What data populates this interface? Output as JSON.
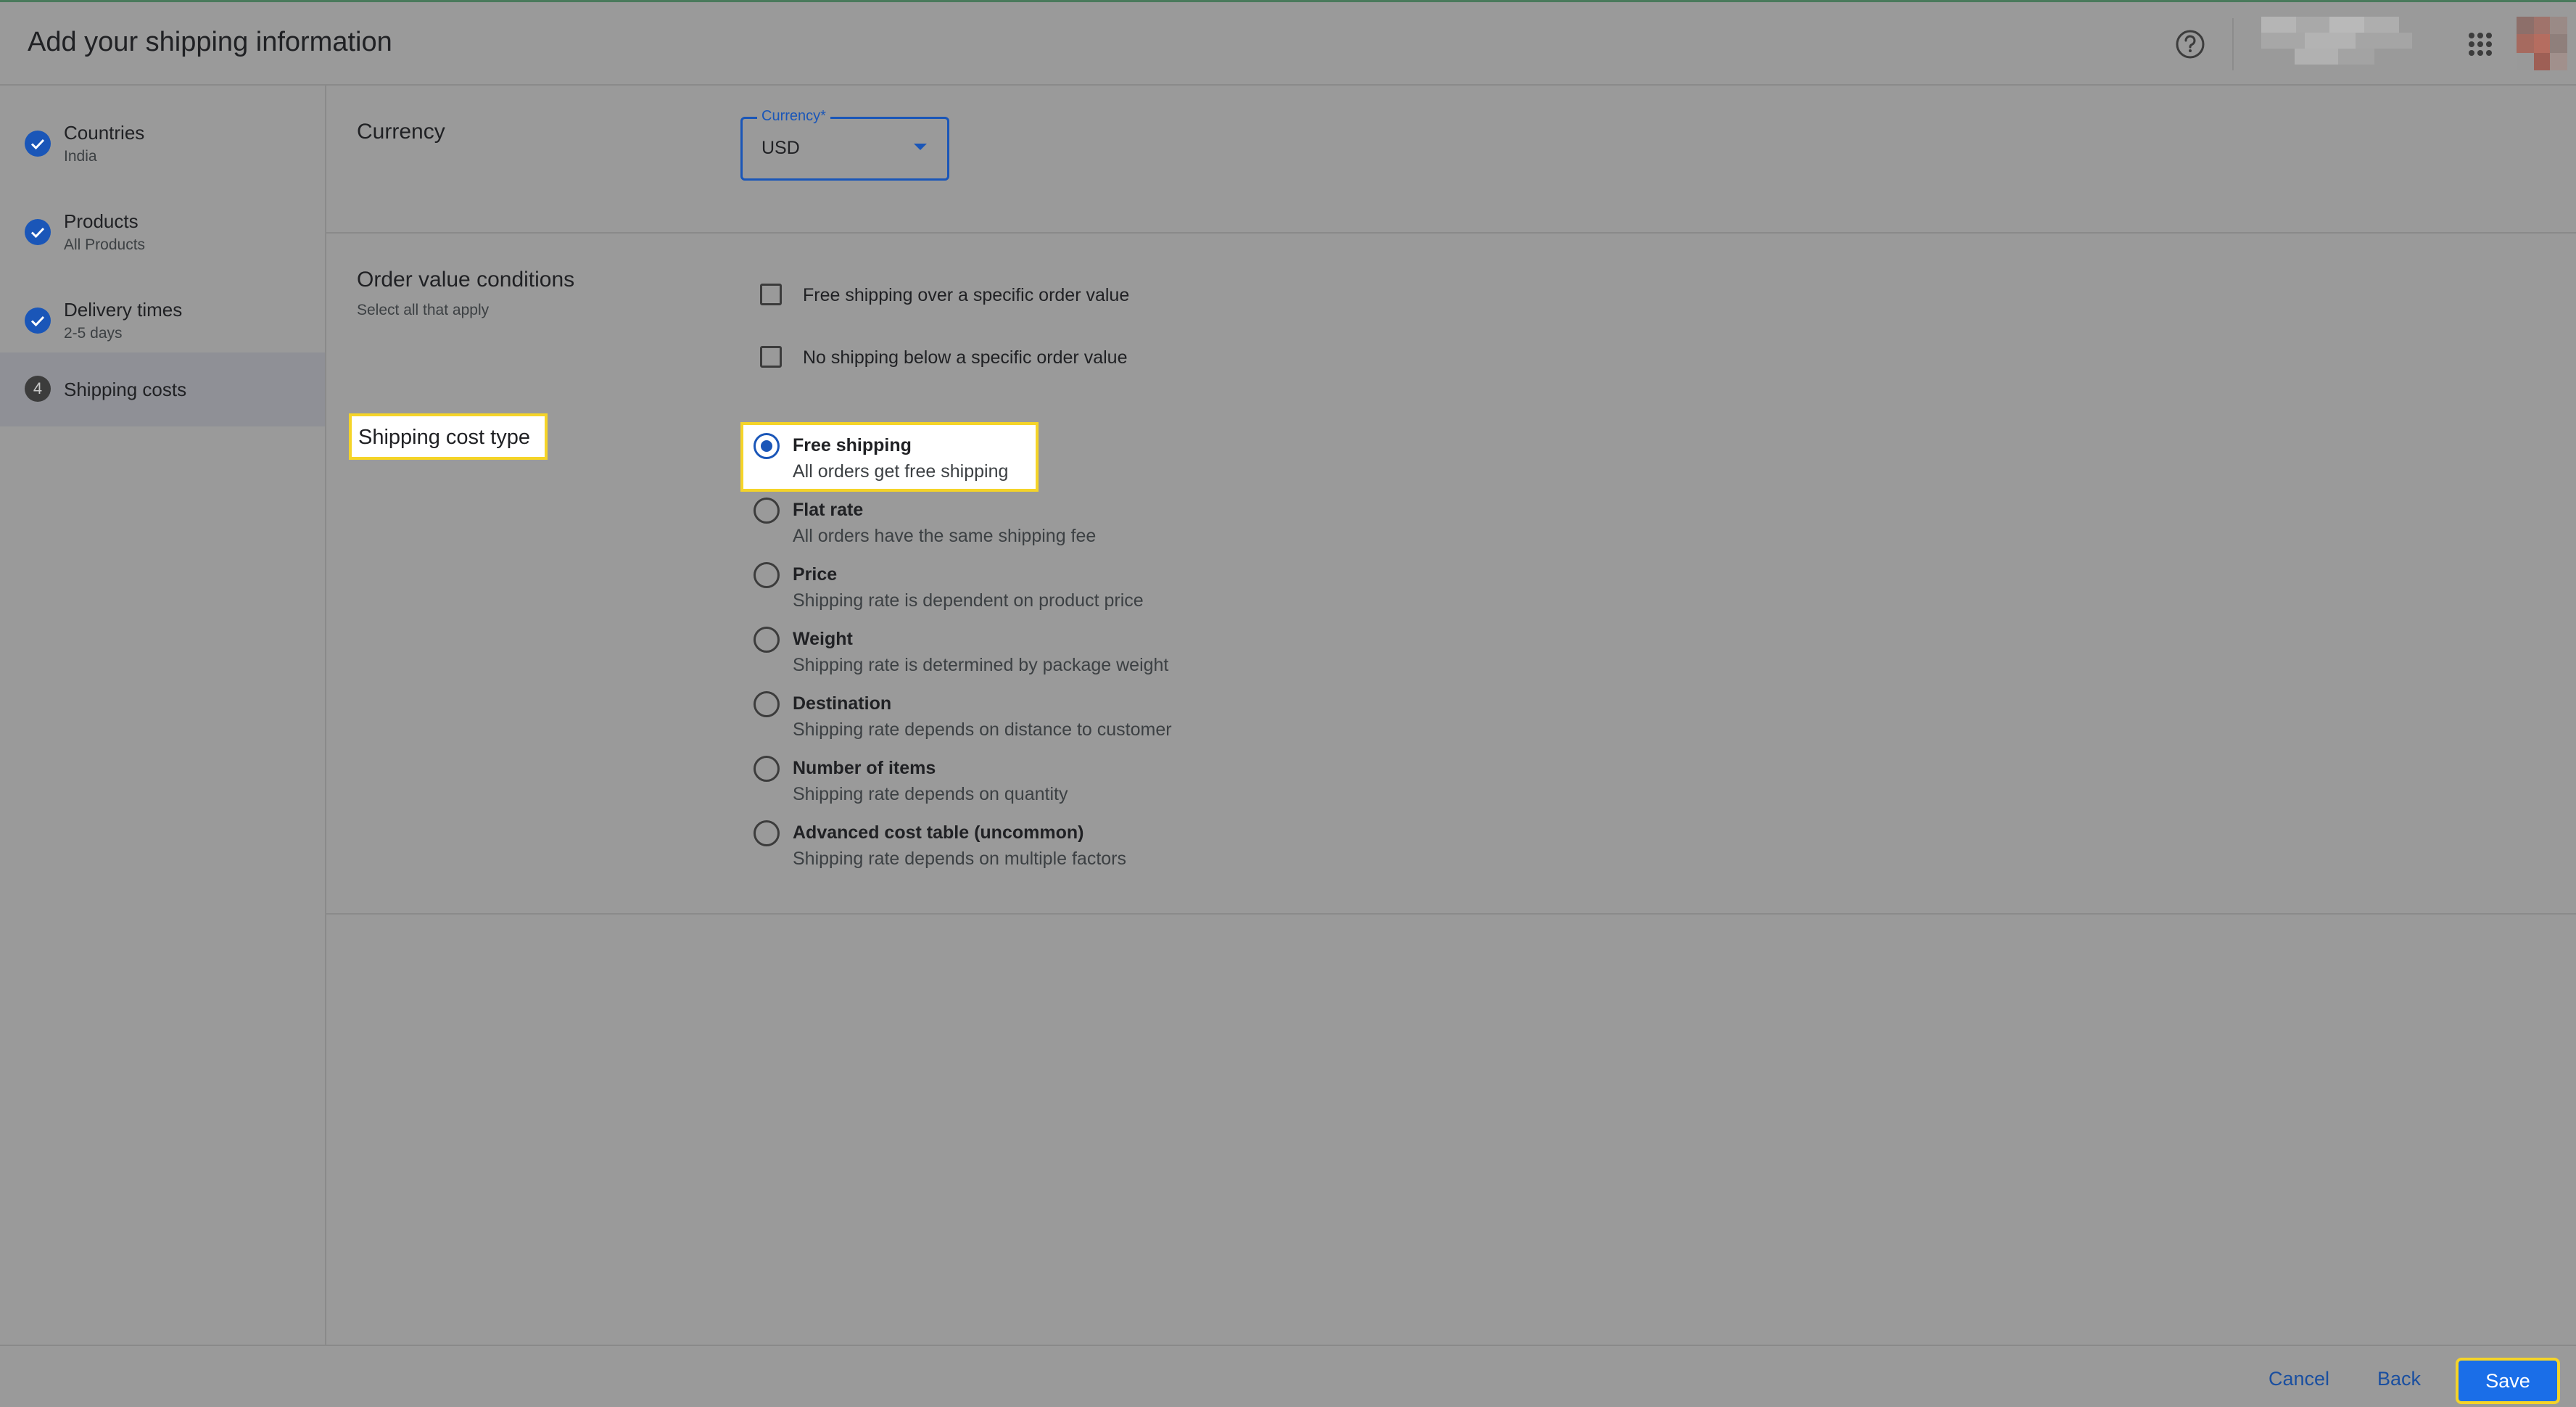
{
  "header": {
    "title": "Add your shipping information"
  },
  "sidebar": {
    "steps": [
      {
        "label": "Countries",
        "sub": "India",
        "status": "done"
      },
      {
        "label": "Products",
        "sub": "All Products",
        "status": "done"
      },
      {
        "label": "Delivery times",
        "sub": "2-5 days",
        "status": "done"
      },
      {
        "label": "Shipping costs",
        "number": "4",
        "status": "current"
      }
    ]
  },
  "currency": {
    "label": "Currency",
    "field_label": "Currency*",
    "value": "USD"
  },
  "order_value": {
    "label": "Order value conditions",
    "sub": "Select all that apply",
    "options": [
      {
        "label": "Free shipping over a specific order value",
        "checked": false
      },
      {
        "label": "No shipping below a specific order value",
        "checked": false
      }
    ]
  },
  "shipping_cost_type": {
    "label": "Shipping cost type",
    "options": [
      {
        "title": "Free shipping",
        "sub": "All orders get free shipping",
        "selected": true
      },
      {
        "title": "Flat rate",
        "sub": "All orders have the same shipping fee",
        "selected": false
      },
      {
        "title": "Price",
        "sub": "Shipping rate is dependent on product price",
        "selected": false
      },
      {
        "title": "Weight",
        "sub": "Shipping rate is determined by package weight",
        "selected": false
      },
      {
        "title": "Destination",
        "sub": "Shipping rate depends on distance to customer",
        "selected": false
      },
      {
        "title": "Number of items",
        "sub": "Shipping rate depends on quantity",
        "selected": false
      },
      {
        "title": "Advanced cost table (uncommon)",
        "sub": "Shipping rate depends on multiple factors",
        "selected": false
      }
    ]
  },
  "footer": {
    "cancel_label": "Cancel",
    "back_label": "Back",
    "save_label": "Save"
  },
  "colors": {
    "accent": "#1a56b8",
    "highlight": "#f5d428",
    "save_button": "#1a6ee8"
  },
  "icons": {
    "help": "help-circle-icon",
    "apps": "apps-grid-icon",
    "step_done": "check-circle-icon"
  }
}
